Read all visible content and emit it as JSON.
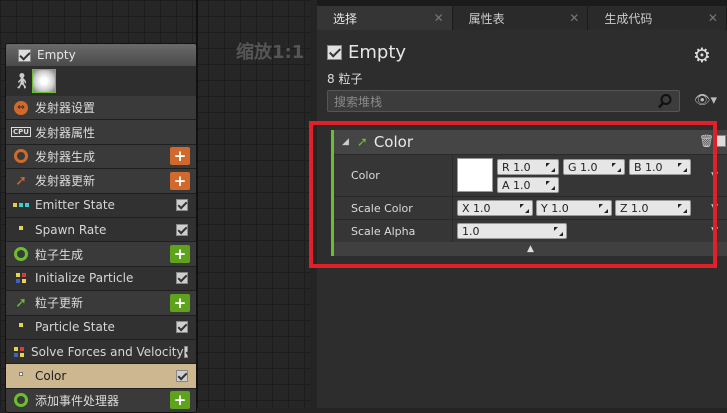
{
  "graph": {
    "zoom_label": "缩放1:1"
  },
  "emitter": {
    "name": "Empty",
    "modules": [
      {
        "label": "发射器设置",
        "kind": "hdr",
        "icon": "emitter-settings-icon",
        "action": "none"
      },
      {
        "label": "发射器属性",
        "kind": "hdr",
        "icon": "cpu-icon",
        "action": "none"
      },
      {
        "label": "发射器生成",
        "kind": "hdr",
        "icon": "ring-orange-icon",
        "action": "orange"
      },
      {
        "label": "发射器更新",
        "kind": "hdr",
        "icon": "arrow-orange-icon",
        "action": "orange"
      },
      {
        "label": "Emitter State",
        "kind": "sub",
        "icon": "dots-icon",
        "action": "check"
      },
      {
        "label": "Spawn Rate",
        "kind": "sub",
        "icon": "dot-yellow-icon",
        "action": "check"
      },
      {
        "label": "粒子生成",
        "kind": "hdr",
        "icon": "ring-green-icon",
        "action": "green"
      },
      {
        "label": "Initialize Particle",
        "kind": "sub",
        "icon": "dots-multi-icon",
        "action": "check"
      },
      {
        "label": "粒子更新",
        "kind": "hdr",
        "icon": "arrow-green-icon",
        "action": "green"
      },
      {
        "label": "Particle State",
        "kind": "sub",
        "icon": "dot-yellow-icon",
        "action": "check"
      },
      {
        "label": "Solve Forces and Velocity",
        "kind": "sub",
        "icon": "dots-multi-icon",
        "action": "check"
      },
      {
        "label": "Color",
        "kind": "sel",
        "icon": "dot-white-icon",
        "action": "check"
      },
      {
        "label": "添加事件处理器",
        "kind": "hdr",
        "icon": "ring-green-icon",
        "action": "green"
      }
    ]
  },
  "tabs": [
    {
      "label": "选择",
      "active": true
    },
    {
      "label": "属性表",
      "active": false
    },
    {
      "label": "生成代码",
      "active": false
    }
  ],
  "details": {
    "title": "Empty",
    "count": "8 粒子",
    "search_placeholder": "搜索堆栈"
  },
  "color_module": {
    "title": "Color",
    "props": {
      "color_label": "Color",
      "r": "R 1.0",
      "g": "G 1.0",
      "b": "B 1.0",
      "a": "A 1.0",
      "scale_color_label": "Scale Color",
      "sx": "X 1.0",
      "sy": "Y 1.0",
      "sz": "Z 1.0",
      "scale_alpha_label": "Scale Alpha",
      "alpha": "1.0"
    },
    "color_swatch": "#ffffff",
    "accent": "#6bbe2f"
  },
  "colors": {
    "highlight": "#e0202a",
    "selected_row": "#cdb791",
    "orange": "#d2692c",
    "green": "#5fa31d"
  }
}
